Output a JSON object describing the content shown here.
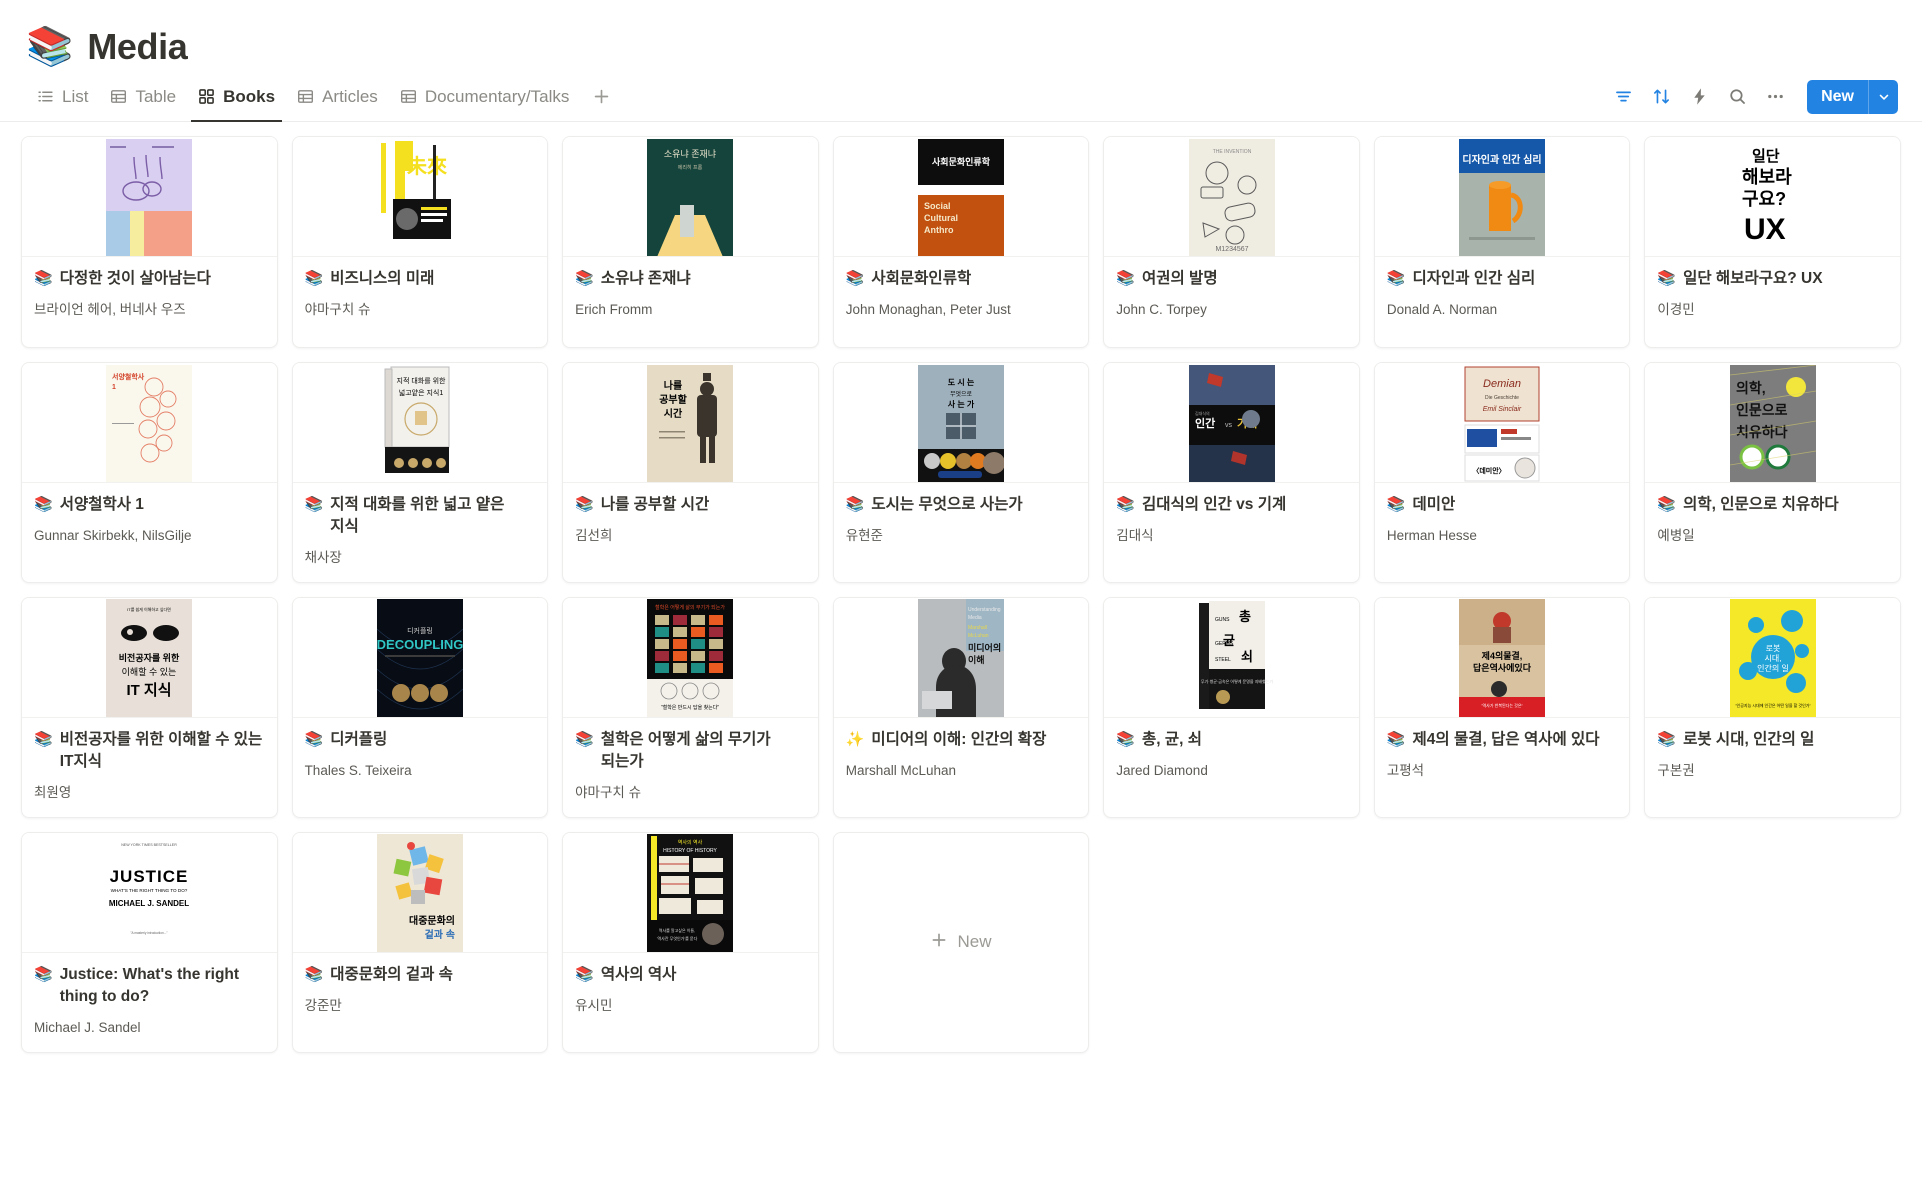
{
  "page": {
    "emoji": "📚",
    "emoji_name": "books-emoji",
    "title": "Media"
  },
  "views": {
    "tabs": [
      {
        "label": "List",
        "icon": "list-icon",
        "active": false
      },
      {
        "label": "Table",
        "icon": "table-icon",
        "active": false
      },
      {
        "label": "Books",
        "icon": "gallery-icon",
        "active": true
      },
      {
        "label": "Articles",
        "icon": "table-icon",
        "active": false
      },
      {
        "label": "Documentary/Talks",
        "icon": "table-icon",
        "active": false
      }
    ],
    "add_view_label": "+"
  },
  "toolbar": {
    "filter": {
      "name": "filter-icon",
      "accent": true
    },
    "sort": {
      "name": "sort-icon",
      "accent": true
    },
    "automation": {
      "name": "lightning-icon",
      "accent": false
    },
    "search": {
      "name": "search-icon",
      "accent": false
    },
    "more": {
      "name": "more-options-icon",
      "accent": false
    },
    "new_label": "New",
    "new_caret": "chevron-down-icon"
  },
  "colors": {
    "accent": "#2383e2",
    "text": "#37352f",
    "muted": "#8b8a85",
    "card_border": "#ededec"
  },
  "gallery": {
    "new_card_label": "New",
    "cards": [
      {
        "emoji": "📚",
        "title": "다정한 것이 살아남는다",
        "author": "브라이언 헤어, 버네사 우즈",
        "cover": "c1"
      },
      {
        "emoji": "📚",
        "title": "비즈니스의 미래",
        "author": "야마구치 슈",
        "cover": "c2"
      },
      {
        "emoji": "📚",
        "title": "소유냐 존재냐",
        "author": "Erich Fromm",
        "cover": "c3"
      },
      {
        "emoji": "📚",
        "title": "사회문화인류학",
        "author": "John Monaghan, Peter Just",
        "cover": "c4"
      },
      {
        "emoji": "📚",
        "title": "여권의 발명",
        "author": "John C. Torpey",
        "cover": "c5"
      },
      {
        "emoji": "📚",
        "title": "디자인과 인간 심리",
        "author": "Donald A. Norman",
        "cover": "c6"
      },
      {
        "emoji": "📚",
        "title": "일단 해보라구요? UX",
        "author": "이경민",
        "cover": "c7"
      },
      {
        "emoji": "📚",
        "title": "서양철학사 1",
        "author": "Gunnar Skirbekk, NilsGilje",
        "cover": "c8"
      },
      {
        "emoji": "📚",
        "title": "지적 대화를 위한 넓고 얕은 지식",
        "author": "채사장",
        "cover": "c9"
      },
      {
        "emoji": "📚",
        "title": "나를 공부할 시간",
        "author": "김선희",
        "cover": "c10"
      },
      {
        "emoji": "📚",
        "title": "도시는 무엇으로 사는가",
        "author": "유현준",
        "cover": "c11"
      },
      {
        "emoji": "📚",
        "title": "김대식의 인간 vs 기계",
        "author": "김대식",
        "cover": "c12"
      },
      {
        "emoji": "📚",
        "title": "데미안",
        "author": "Herman Hesse",
        "cover": "c13"
      },
      {
        "emoji": "📚",
        "title": "의학, 인문으로 치유하다",
        "author": "예병일",
        "cover": "c14"
      },
      {
        "emoji": "📚",
        "title": "비전공자를 위한 이해할 수 있는 IT지식",
        "author": "최원영",
        "cover": "c15"
      },
      {
        "emoji": "📚",
        "title": "디커플링",
        "author": "Thales S. Teixeira",
        "cover": "c16"
      },
      {
        "emoji": "📚",
        "title": "철학은 어떻게 삶의 무기가 되는가",
        "author": "야마구치 슈",
        "cover": "c17"
      },
      {
        "emoji": "✨",
        "title": "미디어의 이해: 인간의 확장",
        "author": "Marshall McLuhan",
        "cover": "c18"
      },
      {
        "emoji": "📚",
        "title": "총, 균, 쇠",
        "author": "Jared Diamond",
        "cover": "c19"
      },
      {
        "emoji": "📚",
        "title": "제4의 물결, 답은 역사에 있다",
        "author": "고평석",
        "cover": "c20"
      },
      {
        "emoji": "📚",
        "title": "로봇 시대, 인간의 일",
        "author": "구본권",
        "cover": "c21"
      },
      {
        "emoji": "📚",
        "title": "Justice: What's the right thing to do?",
        "author": "Michael J. Sandel",
        "cover": "c22"
      },
      {
        "emoji": "📚",
        "title": "대중문화의 겉과 속",
        "author": "강준만",
        "cover": "c23"
      },
      {
        "emoji": "📚",
        "title": "역사의 역사",
        "author": "유시민",
        "cover": "c24"
      }
    ]
  }
}
